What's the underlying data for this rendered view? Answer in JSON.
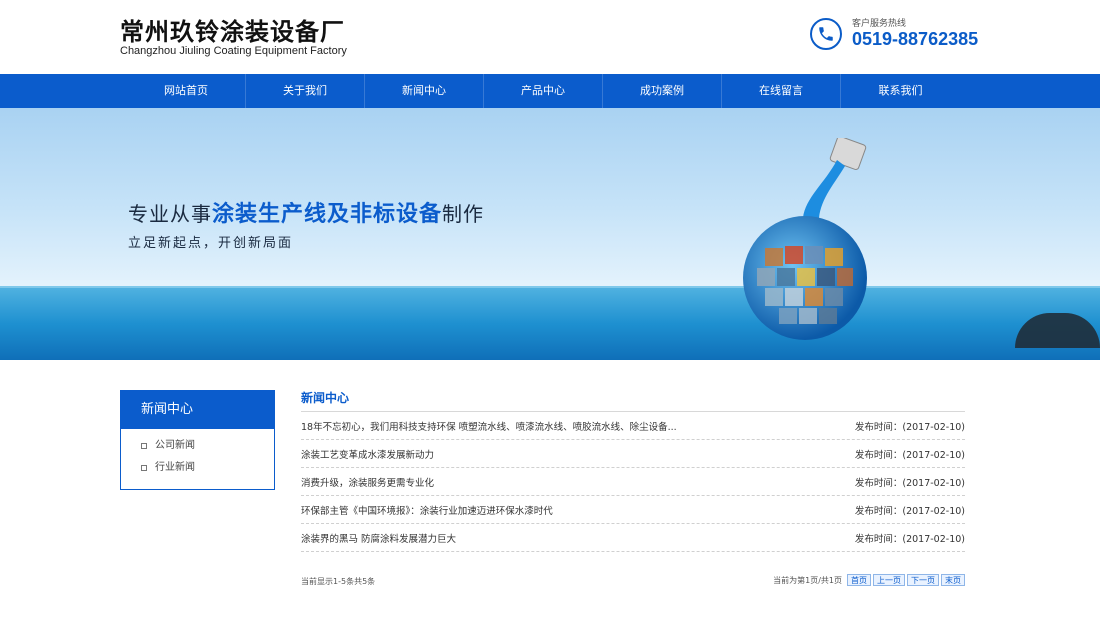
{
  "header": {
    "logo_cn": "常州玖铃涂装设备厂",
    "logo_en": "Changzhou Jiuling Coating Equipment Factory",
    "hotline_label": "客户服务热线",
    "hotline_number": "0519-88762385",
    "phone_icon": "phone-icon"
  },
  "nav": {
    "items": [
      "网站首页",
      "关于我们",
      "新闻中心",
      "产品中心",
      "成功案例",
      "在线留言",
      "联系我们"
    ]
  },
  "banner": {
    "title_pre": "专业从事",
    "title_highlight": "涂装生产线及非标设备",
    "title_post": "制作",
    "subtitle": "立足新起点，开创新局面"
  },
  "sidebar": {
    "title": "新闻中心",
    "items": [
      "公司新闻",
      "行业新闻"
    ]
  },
  "main": {
    "title": "新闻中心",
    "news": [
      {
        "title": "18年不忘初心，我们用科技支持环保 喷塑流水线、喷漆流水线、喷胶流水线、除尘设备...",
        "date": "发布时间：(2017-02-10)"
      },
      {
        "title": "涂装工艺变革成水漆发展新动力",
        "date": "发布时间：(2017-02-10)"
      },
      {
        "title": "消费升级，涂装服务更需专业化",
        "date": "发布时间：(2017-02-10)"
      },
      {
        "title": "环保部主管《中国环境报》：涂装行业加速迈进环保水漆时代",
        "date": "发布时间：(2017-02-10)"
      },
      {
        "title": "涂装界的黑马 防腐涂料发展潜力巨大",
        "date": "发布时间：(2017-02-10)"
      }
    ]
  },
  "pager": {
    "summary": "当前显示1-5条共5条",
    "page_info": "当前为第1页/共1页",
    "first": "首页",
    "prev": "上一页",
    "next": "下一页",
    "last": "末页"
  },
  "colors": {
    "brand_blue": "#0b5ccc"
  }
}
